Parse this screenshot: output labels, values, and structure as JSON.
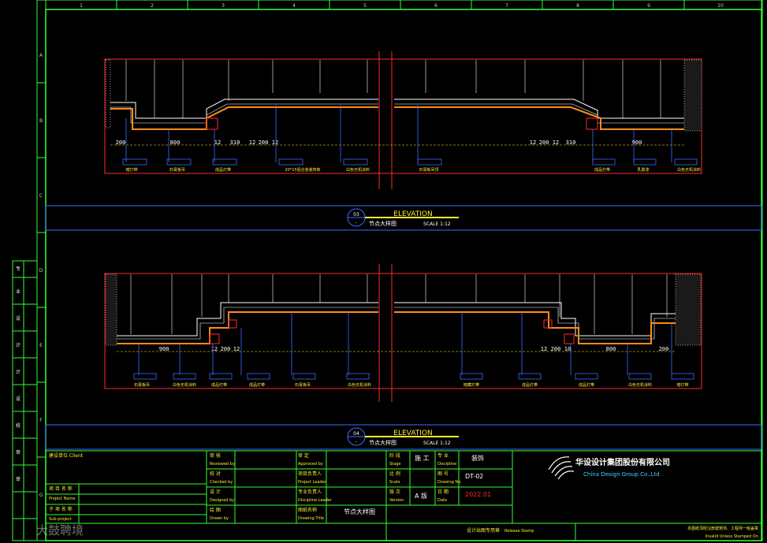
{
  "colors": {
    "background": "#000000",
    "frame": "#33ff33",
    "section_red": "#ff2a2a",
    "orange": "#ff8c1a",
    "blue": "#3b6cff",
    "yellow": "#ffee33",
    "white": "#ffffff",
    "cyan": "#3fd6ff",
    "gray": "#9a9a9a"
  },
  "grid_columns": [
    "1",
    "2",
    "3",
    "4",
    "5",
    "6",
    "7",
    "8",
    "9",
    "10"
  ],
  "grid_rows": [
    "A",
    "B",
    "C",
    "D",
    "E",
    "F",
    "G"
  ],
  "details": [
    {
      "number": "03",
      "title": "ELEVATION",
      "subtitle": "节点大样图",
      "scale": "SCALE 1:12",
      "dimensions_left": [
        "200",
        "800",
        "12",
        "310",
        "12",
        "200",
        "12"
      ],
      "dimensions_right": [
        "12",
        "200",
        "12",
        "310",
        "900"
      ],
      "tags": [
        "暗灯带",
        "石膏板吊",
        "成品灯带",
        "20*15铝合金装饰条",
        "白色无机涂料",
        "石膏板吊顶",
        "成品灯带",
        "乳胶漆",
        "白色无机涂料"
      ]
    },
    {
      "number": "04",
      "title": "ELEVATION",
      "subtitle": "节点大样图",
      "scale": "SCALE 1:12",
      "dimensions_left": [
        "900",
        "12",
        "200",
        "12"
      ],
      "dimensions_right": [
        "12",
        "200",
        "10",
        "800",
        "200"
      ],
      "tags": [
        "石膏板吊",
        "白色无机涂料",
        "成品灯带",
        "成品灯带",
        "石膏板吊",
        "白色无机涂料",
        "暗藏灯带",
        "成品灯带",
        "成品灯带",
        "白色无机涂料",
        "暗灯带"
      ]
    }
  ],
  "title_block": {
    "left_side_labels": [
      "专",
      "业",
      "设",
      "计",
      "计",
      "设",
      "校",
      "审",
      "审"
    ],
    "construction_unit": "建设单位 Client",
    "project_name_cn": "项 目 名 称",
    "project_name_en": "Project Name",
    "sub_project_cn": "子 项 名 称",
    "sub_project_en": "Sub-project",
    "approved_cn": "审  核",
    "approved_en": "Reviewed by",
    "checked_cn": "校  对",
    "checked_en": "Checked by",
    "designed_cn": "设  计",
    "designed_en": "Designed by",
    "drawn_cn": "绘  图",
    "drawn_en": "Drawn by",
    "approver_cn": "审  定",
    "approver_en": "Approved by",
    "pm_cn": "项目负责人",
    "pm_en": "Project Leader",
    "discipline_lead_cn": "专业负责人",
    "discipline_lead_en": "Discipline Leader",
    "drawing_name_cn": "图纸名称",
    "drawing_name_en": "Drawing Title",
    "drawing_name": "节点大样图",
    "stage_label": "阶 段",
    "stage_en": "Stage",
    "stage": "施 工",
    "discipline_label": "专 业",
    "discipline_en": "Discipline",
    "discipline": "装饰",
    "scale_label": "比 例",
    "scale_en": "Scale",
    "drawing_no_label": "图 号",
    "drawing_no_en": "Drawing No.",
    "drawing_no": "DT-02",
    "version_label": "版 次",
    "version_en": "Version",
    "version": "A 版",
    "date_label": "日 期",
    "date_en": "Date",
    "date": "2022.01",
    "company_cn": "华设设计集团股份有限公司",
    "company_en": "China Design Group Co.,Ltd",
    "stamp_label": "设计出图专用章",
    "stamp_en": "Release Stamp",
    "cert_line1": "本图纸须经注册建筑师、工程师一级盖章",
    "cert_line2": "Invalid Unless Stamped On",
    "watermark": "大鼓聘境"
  }
}
